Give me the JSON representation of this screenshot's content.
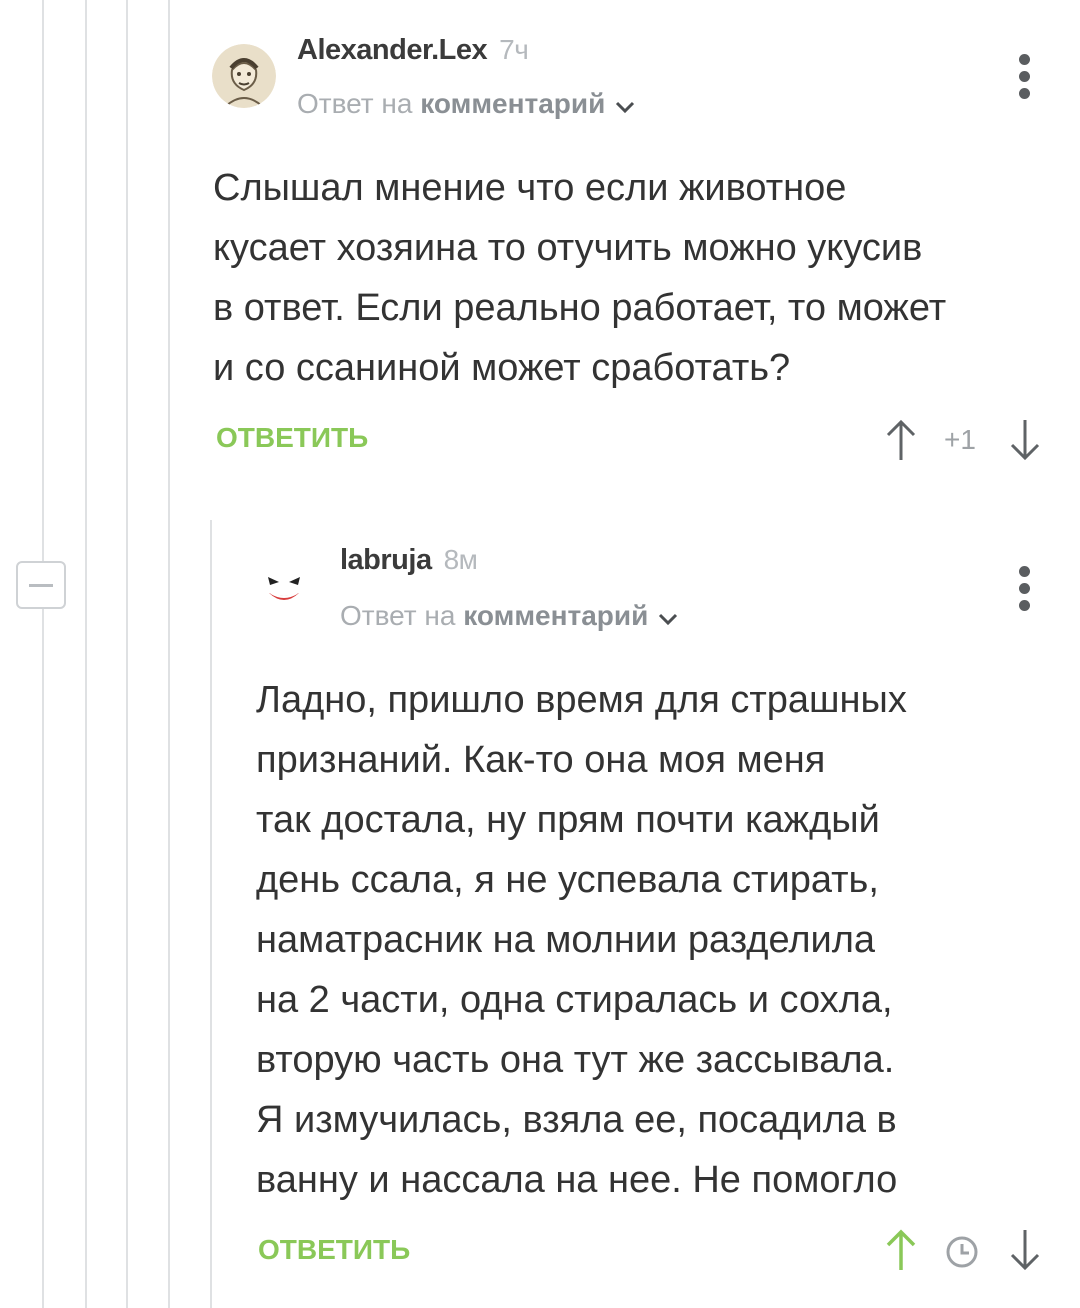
{
  "colors": {
    "accent_green": "#8ac858",
    "text": "#333333",
    "muted": "#a9adb1",
    "thread_line": "#dfe1e3"
  },
  "comments": [
    {
      "author": "Alexander.Lex",
      "time": "7ч",
      "reply_prefix": "Ответ на",
      "reply_link": "комментарий",
      "body": "Слышал мнение что если животное\nкусает хозяина то отучить можно укусив\nв ответ. Если реально работает, то может\nи со ссаниной может сработать?",
      "reply_button": "ОТВЕТИТЬ",
      "score": "+1",
      "avatar_icon": "doodle-face-avatar",
      "upvote_icon": "arrow-up-icon",
      "downvote_icon": "arrow-down-icon",
      "more_icon": "more-vertical-icon"
    },
    {
      "author": "labruja",
      "time": "8м",
      "reply_prefix": "Ответ на",
      "reply_link": "комментарий",
      "body": "Ладно, пришло время для страшных\nпризнаний. Как-то она моя меня\nтак достала, ну прям почти каждый\nдень ссала, я не успевала стирать,\nнаматрасник на молнии разделила\nна 2 части, одна стиралась и сохла,\nвторую часть она тут же зассывала.\nЯ измучилась, взяла ее, посадила в\nванну и нассала на нее. Не помогло",
      "reply_button": "ОТВЕТИТЬ",
      "avatar_icon": "joker-face-avatar",
      "upvote_icon": "arrow-up-icon",
      "pending_icon": "clock-icon",
      "downvote_icon": "arrow-down-icon",
      "more_icon": "more-vertical-icon"
    }
  ]
}
